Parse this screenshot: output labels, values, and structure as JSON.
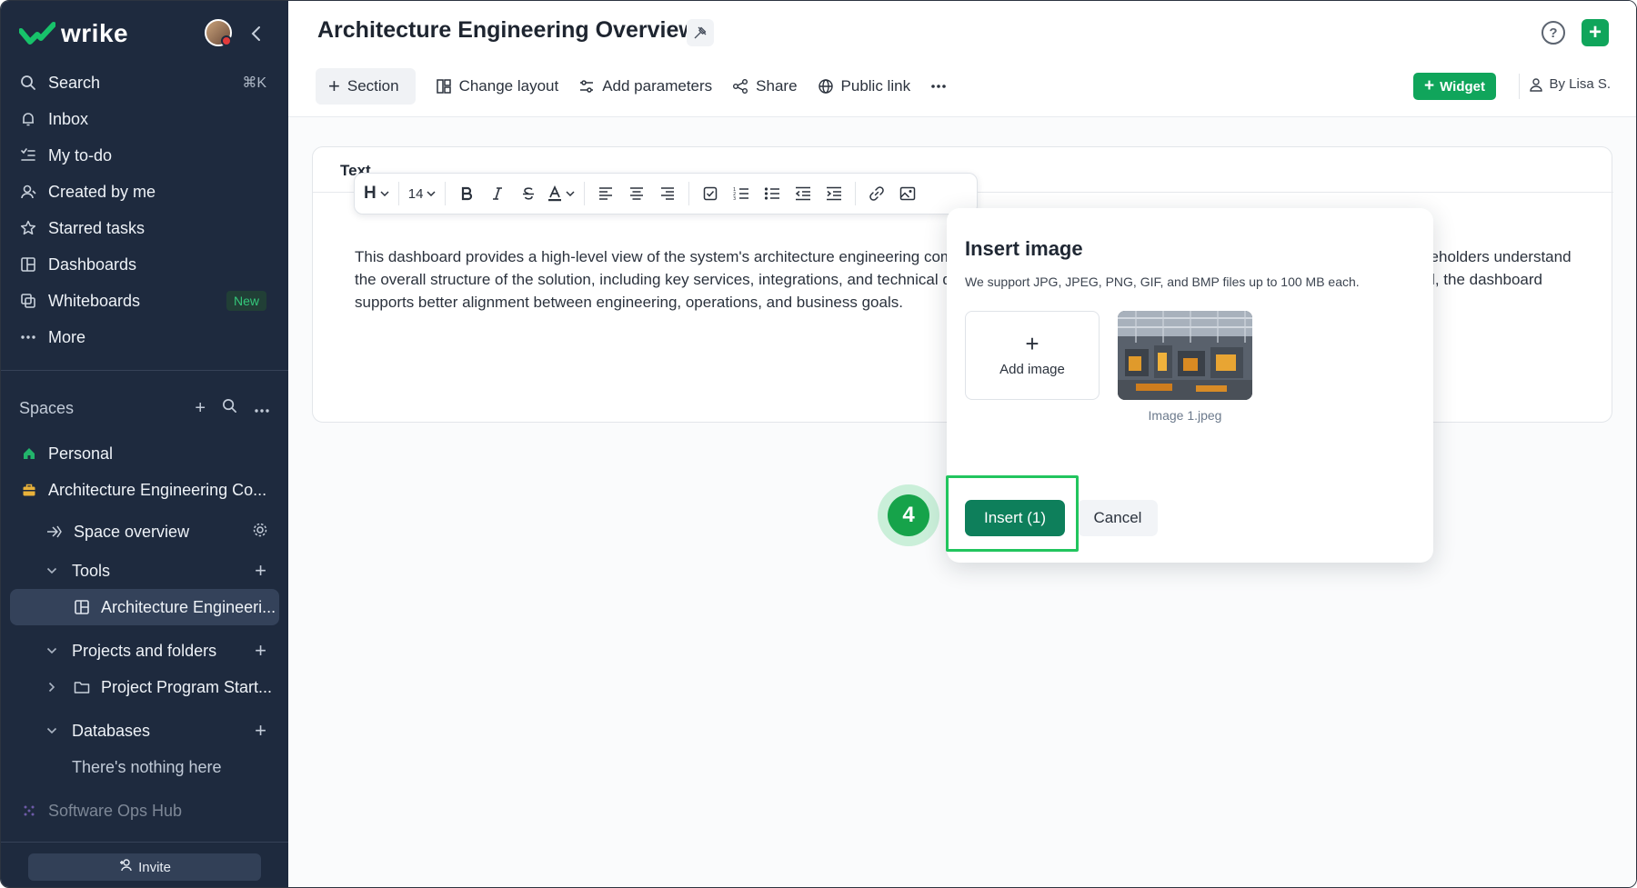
{
  "sidebar": {
    "brand": "wrike",
    "nav": [
      {
        "label": "Search",
        "icon": "search-icon",
        "shortcut": "⌘K"
      },
      {
        "label": "Inbox",
        "icon": "bell-icon"
      },
      {
        "label": "My to-do",
        "icon": "todo-icon"
      },
      {
        "label": "Created by me",
        "icon": "person-icon"
      },
      {
        "label": "Starred tasks",
        "icon": "star-icon"
      },
      {
        "label": "Dashboards",
        "icon": "dashboard-icon"
      },
      {
        "label": "Whiteboards",
        "icon": "whiteboard-icon",
        "badge": "New"
      },
      {
        "label": "More",
        "icon": "more-icon"
      }
    ],
    "spaces_label": "Spaces",
    "tree": {
      "personal": "Personal",
      "space": "Architecture Engineering Co...",
      "space_overview": "Space overview",
      "tools": "Tools",
      "active_dashboard": "Architecture Engineeri...",
      "projects": "Projects and folders",
      "project_item": "Project Program Start...",
      "databases": "Databases",
      "empty": "There's nothing here",
      "other_space": "Software Ops Hub"
    },
    "invite": "Invite"
  },
  "header": {
    "title": "Architecture Engineering Overview",
    "toolbar": {
      "section": "Section",
      "change_layout": "Change layout",
      "add_parameters": "Add parameters",
      "share": "Share",
      "public_link": "Public link"
    },
    "widget": "Widget",
    "by_user": "By Lisa S."
  },
  "widget": {
    "title": "Text",
    "body": "This dashboard provides a high-level view of the system's architecture engineering components and how they are organized across the platform. It helps stakeholders understand the overall structure of the solution, including key services, integrations, and technical domains. By visualizing how the architecture is designed and connected, the dashboard supports better alignment between engineering, operations, and business goals.",
    "format": {
      "heading": "H",
      "size": "14"
    }
  },
  "dialog": {
    "title": "Insert image",
    "subtitle": "We support JPG, JPEG, PNG, GIF, and BMP files up to 100 MB each.",
    "add_image": "Add image",
    "image_name": "Image 1.jpeg",
    "insert": "Insert (1)",
    "cancel": "Cancel"
  },
  "step": {
    "number": "4"
  },
  "colors": {
    "sidebar_bg": "#1e2a3e",
    "brand_green": "#10a55b",
    "insert_green": "#0e7f5b",
    "highlight": "#22c55e"
  }
}
